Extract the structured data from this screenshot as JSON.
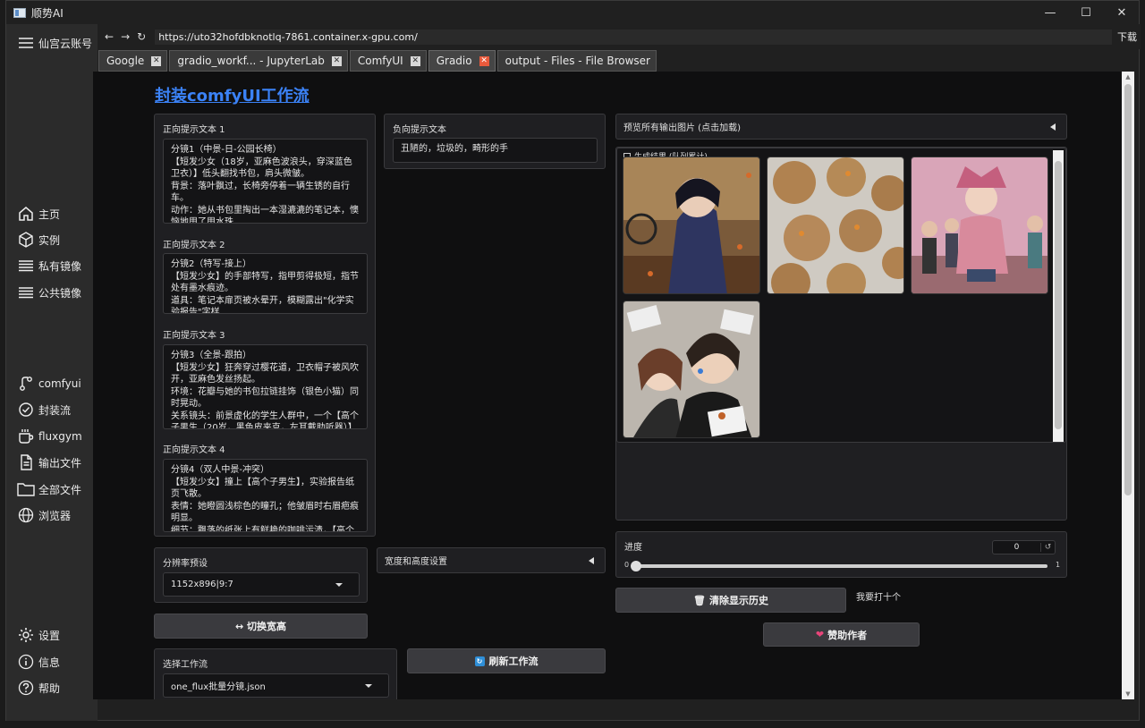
{
  "window": {
    "title": "顺势AI",
    "minimize": "—",
    "maximize": "☐",
    "close": "✕"
  },
  "sidebar": {
    "account": "仙宫云账号",
    "items": [
      {
        "label": "主页",
        "icon": "home-icon"
      },
      {
        "label": "实例",
        "icon": "cube-icon"
      },
      {
        "label": "私有镜像",
        "icon": "stack-icon"
      },
      {
        "label": "公共镜像",
        "icon": "stack-icon"
      },
      {
        "label": "comfyui",
        "icon": "branch-icon"
      },
      {
        "label": "封装流",
        "icon": "check-circle-icon"
      },
      {
        "label": "fluxgym",
        "icon": "cup-icon"
      },
      {
        "label": "输出文件",
        "icon": "file-icon"
      },
      {
        "label": "全部文件",
        "icon": "folder-icon"
      },
      {
        "label": "浏览器",
        "icon": "globe-icon"
      },
      {
        "label": "设置",
        "icon": "gear-icon"
      },
      {
        "label": "信息",
        "icon": "info-icon"
      },
      {
        "label": "帮助",
        "icon": "help-icon"
      }
    ]
  },
  "browser": {
    "back": "←",
    "forward": "→",
    "reload": "↻",
    "url": "https://uto32hofdbknotlq-7861.container.x-gpu.com/",
    "download": "下载",
    "tabs": [
      {
        "label": "Google",
        "active": false
      },
      {
        "label": "gradio_workf... - JupyterLab",
        "active": false
      },
      {
        "label": "ComfyUI",
        "active": false
      },
      {
        "label": "Gradio",
        "active": true
      },
      {
        "label": "output - Files - File Browser",
        "active": false
      }
    ],
    "tab_close": "✕"
  },
  "page": {
    "title": "封装comfyUI工作流",
    "prompts": [
      {
        "label": "正向提示文本 1",
        "value": "分镜1（中景-日-公园长椅）\n【短发少女（18岁，亚麻色波浪头，穿深蓝色卫衣）】低头翻找书包，肩头微皱。\n背景：落叶飘过，长椅旁停着一辆生锈的自行车。\n动作：她从书包里掏出一本湿漉漉的笔记本，懊恼地甩了甩水珠"
      },
      {
        "label": "正向提示文本 2",
        "value": "分镜2（特写-接上）\n【短发少女】的手部特写，指甲剪得极短，指节处有墨水痕迹。\n道具：笔记本扉页被水晕开，模糊露出\"化学实验报告\"字样"
      },
      {
        "label": "正向提示文本 3",
        "value": "分镜3（全景-跟拍）\n【短发少女】狂奔穿过樱花道，卫衣帽子被风吹开，亚麻色发丝扬起。\n环境：花瓣与她的书包拉链挂饰（银色小猫）同时晃动。\n关系镜头：前景虚化的学生人群中，一个【高个子男生（20岁，黑色皮夹克，左耳戴助听器）】"
      },
      {
        "label": "正向提示文本 4",
        "value": "分镜4（双人中景-冲突）\n【短发少女】撞上【高个子男生】，实验报告纸页飞散。\n表情：她瞪圆浅棕色的瞳孔；他皱眉时右眉疤痕明显。\n细节：飘落的纸张上有鲜艳的咖啡污渍，【高个"
      }
    ],
    "negative": {
      "label": "负向提示文本",
      "value": "丑陋的，垃圾的，畸形的手"
    },
    "preview_accordion": "预览所有输出图片 (点击加载)",
    "gallery_label": "生成结果 (队列累计)",
    "gallery_icon": "image-icon",
    "resolution": {
      "label": "分辨率预设",
      "value": "1152x896|9:7"
    },
    "size_accordion": "宽度和高度设置",
    "swap_button": "↔ 切换宽高",
    "workflow": {
      "label": "选择工作流",
      "value": "one_flux批量分镜.json"
    },
    "refresh_button": "刷新工作流",
    "refresh_icon": "🔄",
    "progress": {
      "label": "进度",
      "value": "0",
      "min": "0",
      "max": "1",
      "fraction": 0,
      "reset": "↺"
    },
    "clear_button": "清除显示历史",
    "clear_icon": "🗑",
    "note": "我要打十个",
    "sponsor_button": "赞助作者",
    "sponsor_icon": "💖"
  },
  "colors": {
    "accent": "#3b82f6",
    "background": "#0f0f10",
    "panel": "#1f1f22"
  }
}
